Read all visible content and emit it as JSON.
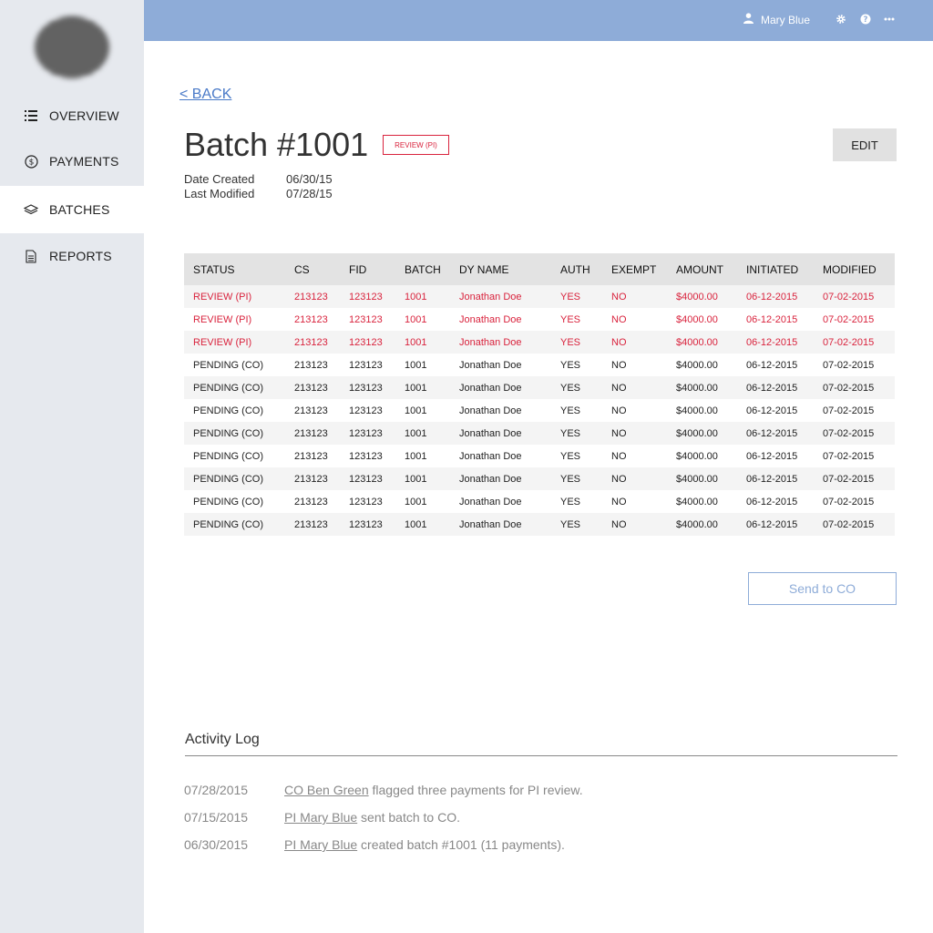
{
  "nav": {
    "overview": "OVERVIEW",
    "payments": "PAYMENTS",
    "batches": "BATCHES",
    "reports": "REPORTS"
  },
  "topbar": {
    "user_name": "Mary Blue"
  },
  "page": {
    "back_label": "< BACK",
    "title": "Batch #1001",
    "status_badge": "REVIEW (PI)",
    "edit_label": "EDIT",
    "date_created_label": "Date Created",
    "date_created_value": "06/30/15",
    "last_modified_label": "Last Modified",
    "last_modified_value": "07/28/15",
    "send_label": "Send to CO"
  },
  "table": {
    "headers": [
      "STATUS",
      "CS",
      "FID",
      "BATCH",
      "DY NAME",
      "AUTH",
      "EXEMPT",
      "AMOUNT",
      "INITIATED",
      "MODIFIED"
    ],
    "rows": [
      [
        "REVIEW (PI)",
        "213123",
        "123123",
        "1001",
        "Jonathan Doe",
        "YES",
        "NO",
        "$4000.00",
        "06-12-2015",
        "07-02-2015"
      ],
      [
        "REVIEW (PI)",
        "213123",
        "123123",
        "1001",
        "Jonathan Doe",
        "YES",
        "NO",
        "$4000.00",
        "06-12-2015",
        "07-02-2015"
      ],
      [
        "REVIEW (PI)",
        "213123",
        "123123",
        "1001",
        "Jonathan Doe",
        "YES",
        "NO",
        "$4000.00",
        "06-12-2015",
        "07-02-2015"
      ],
      [
        "PENDING (CO)",
        "213123",
        "123123",
        "1001",
        "Jonathan Doe",
        "YES",
        "NO",
        "$4000.00",
        "06-12-2015",
        "07-02-2015"
      ],
      [
        "PENDING (CO)",
        "213123",
        "123123",
        "1001",
        "Jonathan Doe",
        "YES",
        "NO",
        "$4000.00",
        "06-12-2015",
        "07-02-2015"
      ],
      [
        "PENDING (CO)",
        "213123",
        "123123",
        "1001",
        "Jonathan Doe",
        "YES",
        "NO",
        "$4000.00",
        "06-12-2015",
        "07-02-2015"
      ],
      [
        "PENDING (CO)",
        "213123",
        "123123",
        "1001",
        "Jonathan Doe",
        "YES",
        "NO",
        "$4000.00",
        "06-12-2015",
        "07-02-2015"
      ],
      [
        "PENDING (CO)",
        "213123",
        "123123",
        "1001",
        "Jonathan Doe",
        "YES",
        "NO",
        "$4000.00",
        "06-12-2015",
        "07-02-2015"
      ],
      [
        "PENDING (CO)",
        "213123",
        "123123",
        "1001",
        "Jonathan Doe",
        "YES",
        "NO",
        "$4000.00",
        "06-12-2015",
        "07-02-2015"
      ],
      [
        "PENDING (CO)",
        "213123",
        "123123",
        "1001",
        "Jonathan Doe",
        "YES",
        "NO",
        "$4000.00",
        "06-12-2015",
        "07-02-2015"
      ],
      [
        "PENDING (CO)",
        "213123",
        "123123",
        "1001",
        "Jonathan Doe",
        "YES",
        "NO",
        "$4000.00",
        "06-12-2015",
        "07-02-2015"
      ]
    ]
  },
  "activity": {
    "title": "Activity Log",
    "entries": [
      {
        "date": "07/28/2015",
        "who": "CO Ben Green",
        "text": " flagged three payments for PI review."
      },
      {
        "date": "07/15/2015",
        "who": "PI Mary Blue",
        "text": " sent batch to CO."
      },
      {
        "date": "06/30/2015",
        "who": "PI Mary Blue",
        "text": " created batch #1001 (11 payments)."
      }
    ]
  },
  "colors": {
    "topbar": "#8eacd8",
    "sidebar": "#e6e9ee",
    "flag_red": "#d9233d",
    "link_blue": "#4a7ac8"
  },
  "icons": {
    "overview": "list-icon",
    "payments": "dollar-circle-icon",
    "batches": "layers-icon",
    "reports": "document-icon",
    "user": "user-icon",
    "settings": "gear-icon",
    "help": "help-icon",
    "more": "more-icon"
  }
}
